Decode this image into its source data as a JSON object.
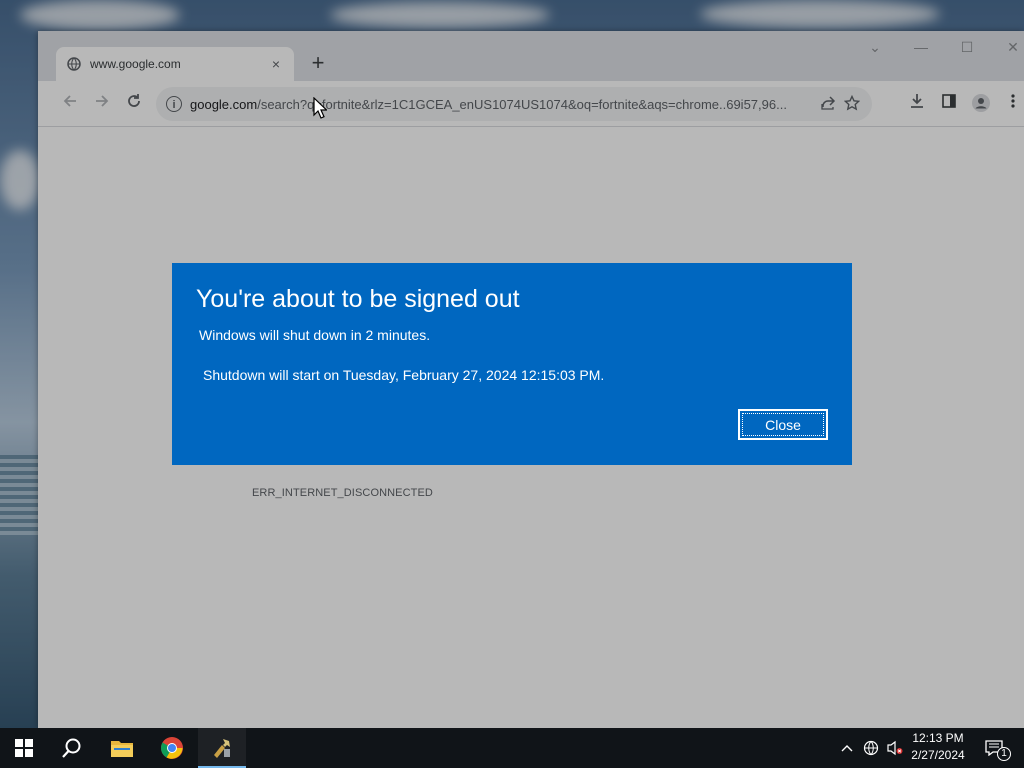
{
  "browser": {
    "tab": {
      "title": "www.google.com",
      "favicon": "globe-icon",
      "close": "×"
    },
    "new_tab": "+",
    "window_controls": {
      "dropdown": "⌄",
      "minimize": "—",
      "maximize": "☐",
      "close": "✕"
    },
    "address": {
      "host": "google.com",
      "path": "/search?q=fortnite&rlz=1C1GCEA_enUS1074US1074&oq=fortnite&aqs=chrome..69i57,96..."
    },
    "error_code": "ERR_INTERNET_DISCONNECTED"
  },
  "dialog": {
    "title": "You're about to be signed out",
    "message": "Windows will shut down in 2 minutes.",
    "detail": "Shutdown will start on Tuesday, February 27, 2024 12:15:03 PM.",
    "close_label": "Close",
    "background": "#0067c0"
  },
  "taskbar": {
    "clock": {
      "time": "12:13 PM",
      "date": "2/27/2024"
    },
    "notification_count": "1",
    "apps": [
      "start-icon",
      "search-icon",
      "file-explorer-icon",
      "chrome-icon",
      "tool-icon"
    ]
  }
}
